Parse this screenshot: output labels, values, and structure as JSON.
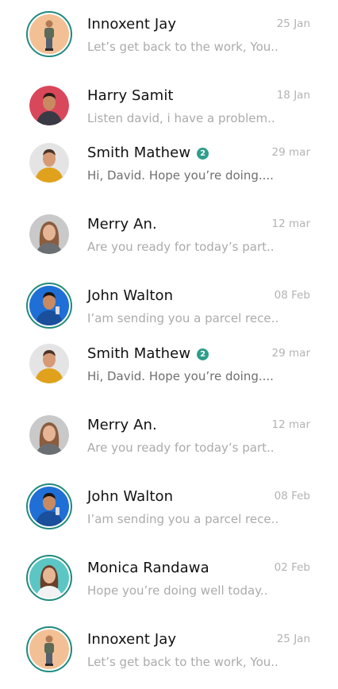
{
  "colors": {
    "accent": "#1f8a7e",
    "badge": "#2f9e8c",
    "name": "#111111",
    "muted": "#ababab"
  },
  "conversations": [
    {
      "name": "Innoxent Jay",
      "date": "25 Jan",
      "preview": "Let’s get back to the work, You..",
      "unread": "",
      "avatar_icon": "person-peach-bg-icon"
    },
    {
      "name": "Harry Samit",
      "date": "18 Jan",
      "preview": "Listen david, i have a problem..",
      "unread": "",
      "avatar_icon": "person-red-bg-icon"
    },
    {
      "name": "Smith Mathew",
      "date": "29 mar",
      "preview": "Hi, David. Hope you’re doing....",
      "unread": "2",
      "avatar_icon": "person-yellow-shirt-icon"
    },
    {
      "name": "Merry An.",
      "date": "12 mar",
      "preview": "Are you ready for today’s part..",
      "unread": "",
      "avatar_icon": "person-woman-grey-bg-icon"
    },
    {
      "name": "John Walton",
      "date": "08 Feb",
      "preview": "I’am sending you a parcel rece..",
      "unread": "",
      "avatar_icon": "person-blue-bg-icon"
    },
    {
      "name": "Smith Mathew",
      "date": "29 mar",
      "preview": "Hi, David. Hope you’re doing....",
      "unread": "2",
      "avatar_icon": "person-yellow-shirt-icon"
    },
    {
      "name": "Merry An.",
      "date": "12 mar",
      "preview": "Are you ready for today’s part..",
      "unread": "",
      "avatar_icon": "person-woman-grey-bg-icon"
    },
    {
      "name": "John Walton",
      "date": "08 Feb",
      "preview": "I’am sending you a parcel rece..",
      "unread": "",
      "avatar_icon": "person-blue-bg-icon"
    },
    {
      "name": "Monica Randawa",
      "date": "02 Feb",
      "preview": "Hope you’re doing well today..",
      "unread": "",
      "avatar_icon": "person-woman-teal-bg-icon"
    },
    {
      "name": "Innoxent Jay",
      "date": "25 Jan",
      "preview": "Let’s get back to the work, You..",
      "unread": "",
      "avatar_icon": "person-peach-bg-icon"
    }
  ]
}
